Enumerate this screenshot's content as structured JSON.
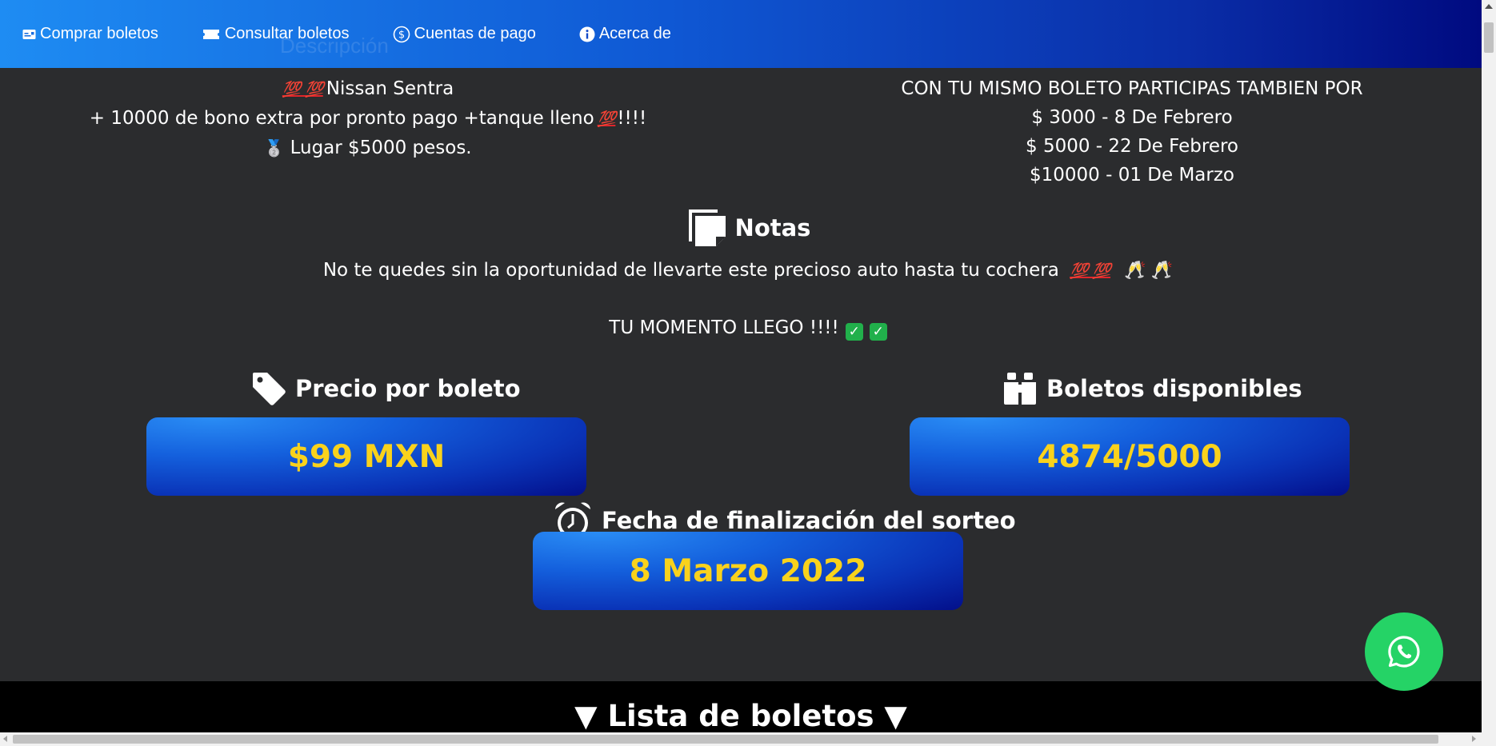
{
  "nav": {
    "items": [
      {
        "label": "Comprar boletos",
        "icon": "ticket-card-icon"
      },
      {
        "label": "Consultar boletos",
        "icon": "ticket-icon"
      },
      {
        "label": "Cuentas de pago",
        "icon": "dollar-circle-icon"
      },
      {
        "label": "Acerca de",
        "icon": "info-icon"
      }
    ],
    "ghost_text": "Descripción"
  },
  "prizes": {
    "first_emoji": "💯 💯",
    "first": "Nissan Sentra",
    "bonus": "+ 10000 de bono extra por pronto pago +tanque lleno",
    "bonus_emoji": "💯",
    "bonus_suffix": "!!!!",
    "second_medal": "🥈",
    "second": "Lugar $5000 pesos."
  },
  "extra_draws": {
    "heading": "CON TU MISMO BOLETO PARTICIPAS TAMBIEN POR",
    "lines": [
      "$ 3000 - 8 De Febrero",
      "$ 5000 - 22 De Febrero",
      "$10000 - 01 De Marzo"
    ]
  },
  "notes": {
    "title": "Notas",
    "text": "No te quedes sin la oportunidad de llevarte este precioso auto hasta tu cochera",
    "text_emoji": "💯 💯",
    "moment": "TU MOMENTO LLEGO !!!!"
  },
  "price": {
    "title": "Precio por boleto",
    "value": "$99 MXN"
  },
  "available": {
    "title": "Boletos disponibles",
    "value": "4874/5000"
  },
  "end_date": {
    "title": "Fecha de finalización del sorteo",
    "value": "8 Marzo 2022"
  },
  "list": {
    "title": "▼ Lista de boletos ▼"
  },
  "colors": {
    "accent_yellow": "#f9d21c",
    "nav_start": "#1e8cf3",
    "nav_end": "#000a80",
    "background": "#2b2c2e",
    "whatsapp": "#25d366"
  }
}
